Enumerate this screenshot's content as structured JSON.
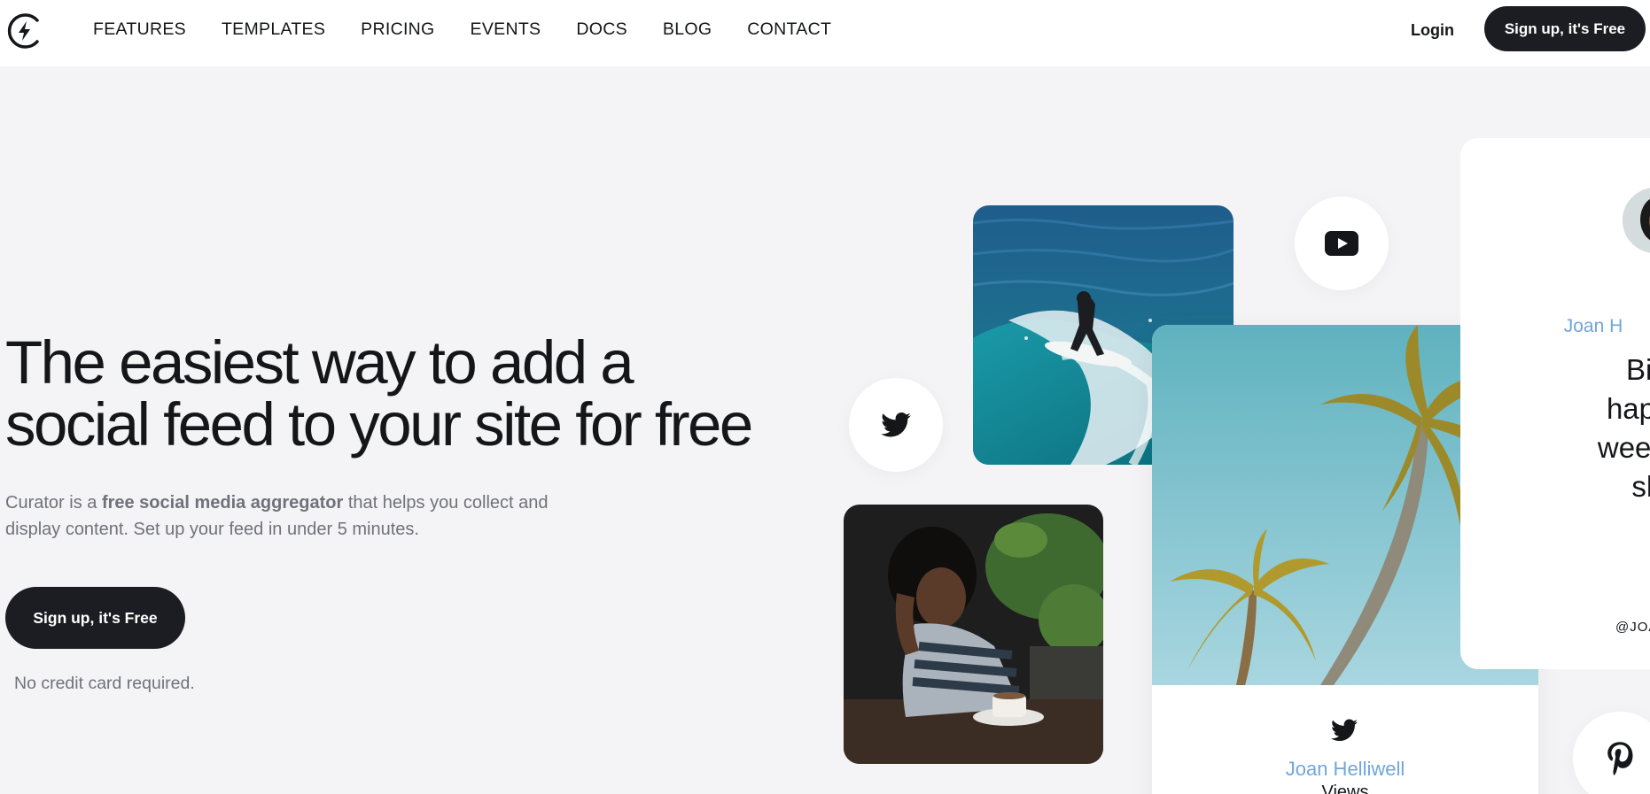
{
  "nav": {
    "logo_icon": "lightning-circle-logo",
    "links": [
      "FEATURES",
      "TEMPLATES",
      "PRICING",
      "EVENTS",
      "DOCS",
      "BLOG",
      "CONTACT"
    ],
    "login": "Login",
    "signup": "Sign up, it's Free"
  },
  "hero": {
    "title_line1": "The easiest way to add a",
    "title_line2": "social feed to your site for free",
    "sub_pre": "Curator is a ",
    "sub_bold": "free social media aggregator",
    "sub_post": " that helps you collect and",
    "sub_line2": "display content. Set up your feed in under 5 minutes.",
    "signup": "Sign up, it's Free",
    "no_cc": "No credit card required."
  },
  "feed": {
    "youtube_icon": "youtube-icon",
    "twitter_icon": "twitter-icon",
    "pinterest_icon": "pinterest-icon",
    "palm_card": {
      "name": "Joan Helliwell",
      "views": "Views"
    },
    "text_card": {
      "name": "Joan H",
      "body_lines": [
        "Big t",
        "happen",
        "week, ca",
        "sha"
      ],
      "handle": "@JOA"
    }
  },
  "colors": {
    "background": "#f4f4f6",
    "dark_button": "#1c1d22",
    "link_blue": "#6fa6dc"
  }
}
